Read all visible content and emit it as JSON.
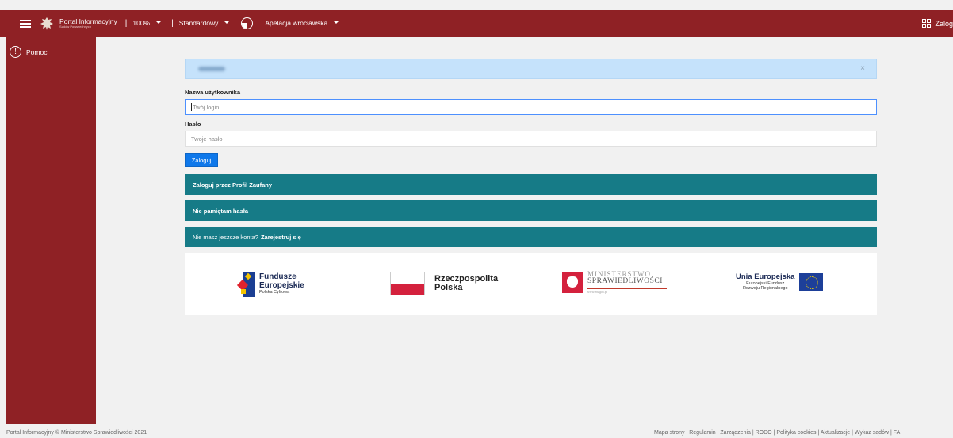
{
  "topbar": {
    "portal_title": "Portal Informacyjny",
    "portal_subtitle": "Sądów Powszechnych",
    "zoom": "100%",
    "contrast": "Standardowy",
    "court": "Apelacja wrocławska",
    "login_label": "Zalog",
    "colors": {
      "brand": "#8f2125"
    }
  },
  "sidebar": {
    "help_label": "Pomoc"
  },
  "alert": {
    "close_symbol": "×"
  },
  "login_form": {
    "username_label": "Nazwa użytkownika",
    "username_placeholder": "Twój login",
    "password_label": "Hasło",
    "password_placeholder": "Twoje hasło",
    "submit_label": "Zaloguj"
  },
  "actions": {
    "profil_zaufany": "Zaloguj przez Profil Zaufany",
    "forgot_password": "Nie pamiętam hasła",
    "no_account_text": "Nie masz jeszcze konta?",
    "register_link": "Zarejestruj się"
  },
  "logos": {
    "fe_line1": "Fundusze",
    "fe_line2": "Europejskie",
    "fe_line3": "Polska Cyfrowa",
    "rp_line1": "Rzeczpospolita",
    "rp_line2": "Polska",
    "ms_line1": "MINISTERSTWO",
    "ms_line2": "SPRAWIEDLIWOŚCI",
    "ms_url": "www.ms.gov.pl",
    "ue_line1": "Unia Europejska",
    "ue_line2": "Europejski Fundusz",
    "ue_line3": "Rozwoju Regionalnego"
  },
  "footer": {
    "copyright": "Portal Informacyjny © Ministerstwo Sprawiedliwości 2021",
    "links": "Mapa strony | Regulamin | Zarządzenia | RODO | Polityka cookies | Aktualizacje | Wykaz sądów | FA"
  }
}
